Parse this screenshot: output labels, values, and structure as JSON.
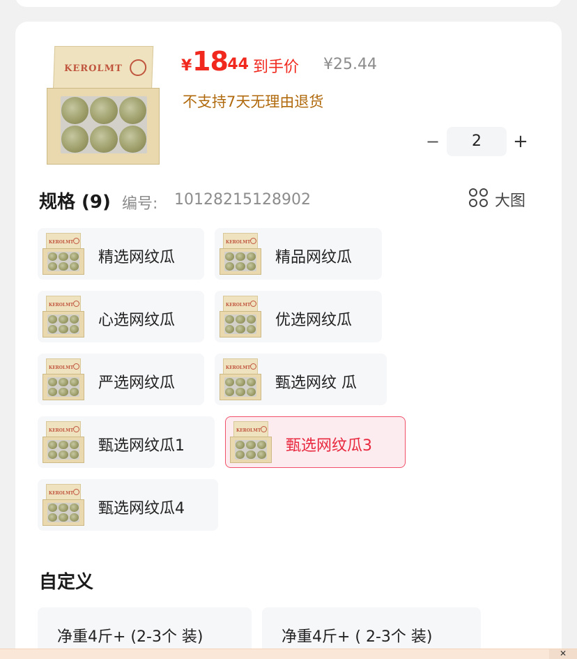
{
  "product": {
    "price_symbol": "¥",
    "price_integer": "18",
    "price_decimal": ".44",
    "price_label": "到手价",
    "original_price": "¥25.44",
    "return_note": "不支持7天无理由退货",
    "image_icon": "melon-box-image",
    "box_brand": "KEROLMT"
  },
  "quantity": {
    "minus": "−",
    "value": "2",
    "plus": "+"
  },
  "spec": {
    "title": "规格 (9)",
    "code_label": "编号:",
    "code_value": "10128215128902",
    "big_image_label": "大图",
    "items": [
      {
        "label": "精选网纹瓜"
      },
      {
        "label": "精品网纹瓜"
      },
      {
        "label": "心选网纹瓜"
      },
      {
        "label": "优选网纹瓜"
      },
      {
        "label": "严选网纹瓜"
      },
      {
        "label": "甄选网纹 瓜"
      },
      {
        "label": "甄选网纹瓜1"
      },
      {
        "label": "甄选网纹瓜3",
        "selected": true
      },
      {
        "label": "甄选网纹瓜4"
      }
    ]
  },
  "custom": {
    "title": "自定义",
    "options": [
      {
        "label": "净重4斤+ (2-3个 装)"
      },
      {
        "label": "净重4斤+ ( 2-3个 装)"
      }
    ]
  },
  "bottom_bar": {
    "close": "✕"
  },
  "colors": {
    "accent_red": "#f0281e",
    "warning_brown": "#b06a0d",
    "selected_bg": "#fdecef",
    "selected_border": "#f0506a"
  }
}
